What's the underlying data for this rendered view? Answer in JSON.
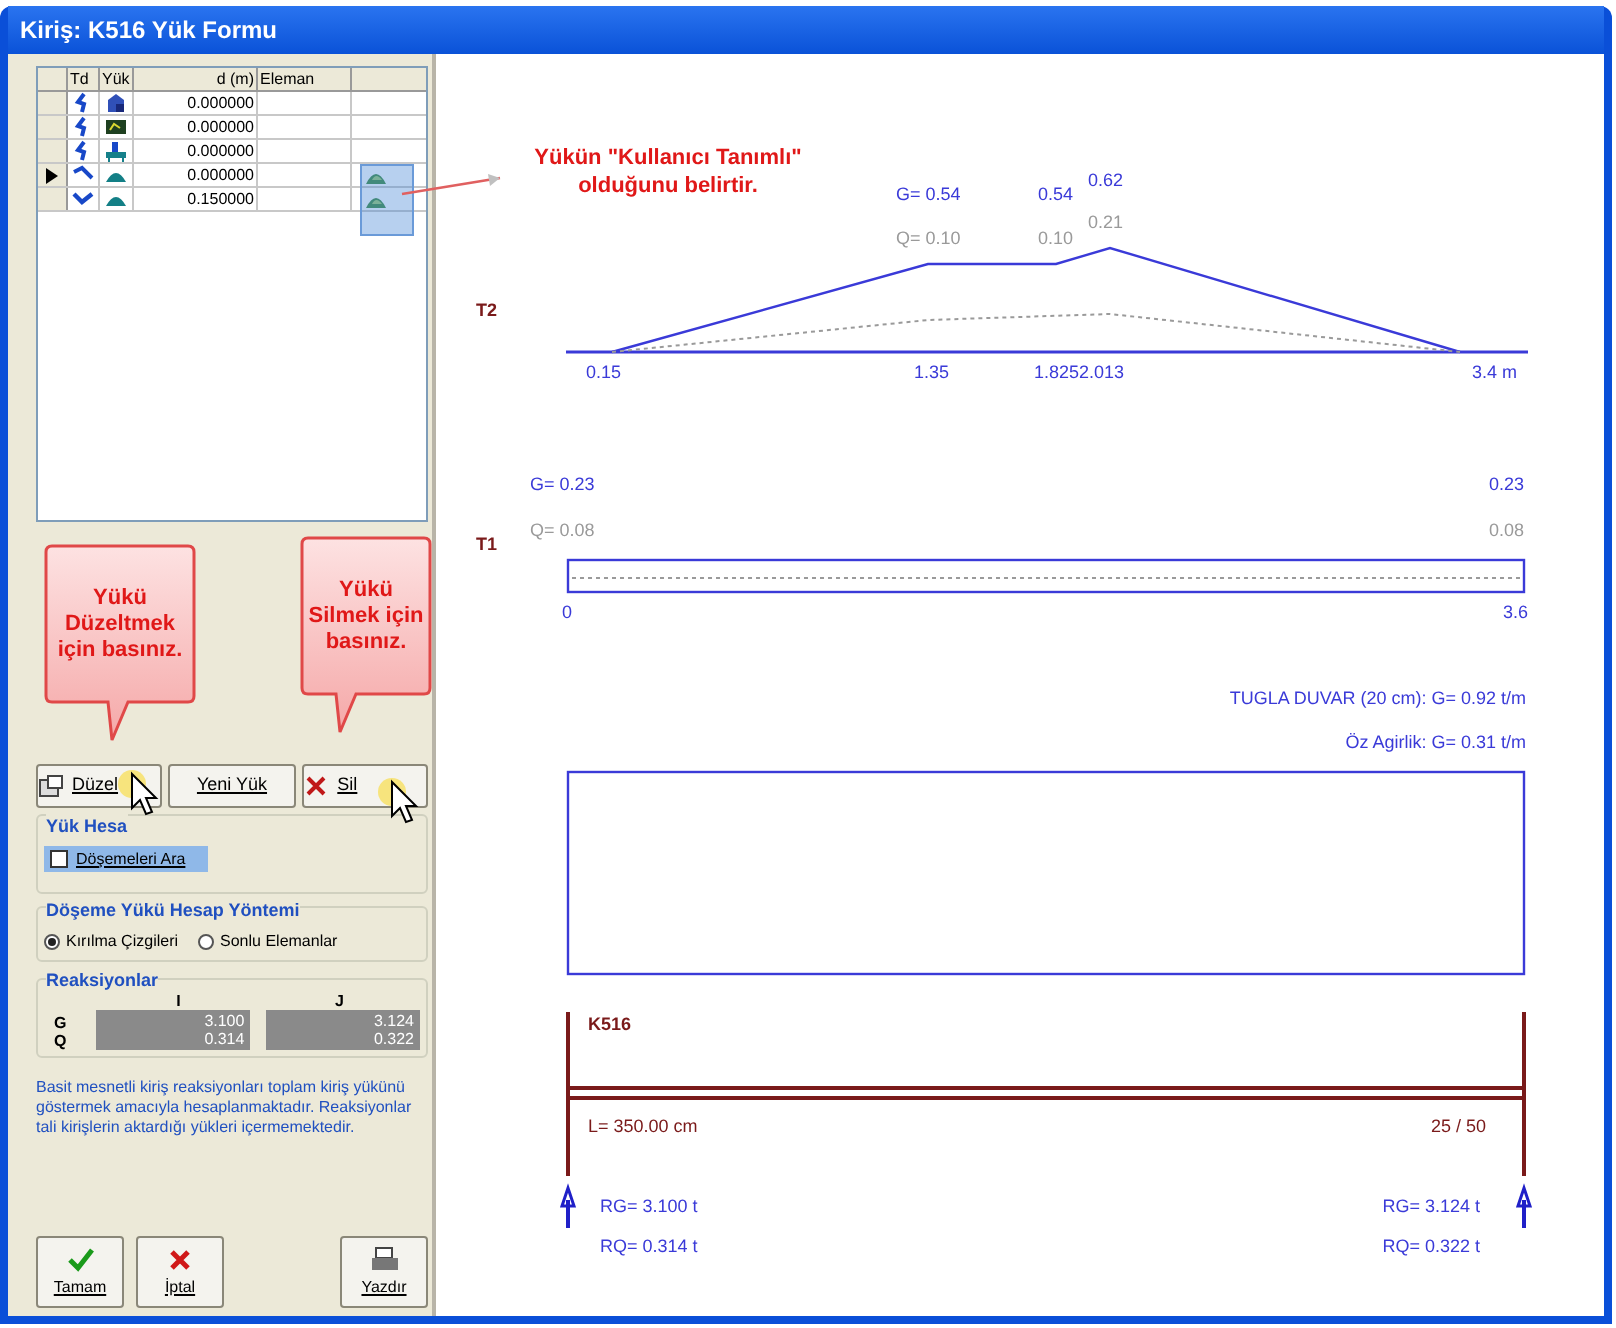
{
  "window": {
    "title": "Kiriş: K516 Yük Formu"
  },
  "grid": {
    "columns": [
      "Td",
      "Yük",
      "d (m)",
      "Eleman"
    ],
    "rows": [
      {
        "selected": false,
        "td": {
          "kind": "hook"
        },
        "load": {
          "kind": "wall"
        },
        "d": "0.000000",
        "user_defined": false
      },
      {
        "selected": false,
        "td": {
          "kind": "hook"
        },
        "load": {
          "kind": "panel"
        },
        "d": "0.000000",
        "user_defined": false
      },
      {
        "selected": false,
        "td": {
          "kind": "hook"
        },
        "load": {
          "kind": "slab"
        },
        "d": "0.000000",
        "user_defined": false
      },
      {
        "selected": true,
        "td": {
          "kind": "slant"
        },
        "load": {
          "kind": "mound"
        },
        "d": "0.000000",
        "user_defined": true
      },
      {
        "selected": false,
        "td": {
          "kind": "down"
        },
        "load": {
          "kind": "mound"
        },
        "d": "0.150000",
        "user_defined": true
      }
    ]
  },
  "callouts": [
    {
      "text": "Yükü Düzeltmek için basınız."
    },
    {
      "text": "Yükü Silmek için basınız."
    }
  ],
  "note": {
    "text": "Yükün \"Kullanıcı Tanımlı\" olduğunu belirtir."
  },
  "buttons": [
    {
      "kind": "edit",
      "label": "Düzel"
    },
    {
      "kind": "new",
      "label": "Yeni Yük"
    },
    {
      "kind": "delete",
      "label": "Sil"
    }
  ],
  "load_calc": {
    "title": "Yük Hesa",
    "checkbox": {
      "label": "Döşemeleri Ara",
      "checked": false
    }
  },
  "method": {
    "title": "Döşeme Yükü Hesap Yöntemi",
    "options": [
      {
        "label": "Kırılma Çizgileri",
        "selected": true
      },
      {
        "label": "Sonlu Elemanlar",
        "selected": false
      }
    ]
  },
  "reactions": {
    "title": "Reaksiyonlar",
    "columns": [
      "I",
      "J"
    ],
    "row_labels": [
      "G",
      "Q"
    ],
    "values": [
      [
        "3.100",
        "0.314"
      ],
      [
        "3.124",
        "0.322"
      ]
    ]
  },
  "info": "Basit mesnetli kiriş reaksiyonları toplam kiriş yükünü göstermek amacıyla hesaplanmaktadır. Reaksiyonlar tali kirişlerin aktardığı yükleri içermemektedir.",
  "footer_buttons": [
    {
      "kind": "ok",
      "label": "Tamam"
    },
    {
      "kind": "cancel",
      "label": "İptal"
    },
    {
      "kind": "print",
      "label": "Yazdır"
    }
  ],
  "diagram": {
    "t2": {
      "label": "T2",
      "g_labels": [
        "G= 0.54",
        "0.54",
        "0.62"
      ],
      "q_labels": [
        "Q= 0.10",
        "0.10",
        "0.21"
      ],
      "x_labels": [
        "0.15",
        "1.35",
        "1.8252.013",
        "3.4 m"
      ]
    },
    "t1": {
      "label": "T1",
      "g_labels": [
        "G= 0.23",
        "0.23"
      ],
      "q_labels": [
        "Q= 0.08",
        "0.08"
      ],
      "x_labels": [
        "0",
        "3.6"
      ]
    },
    "wall_load": "TUGLA DUVAR (20 cm): G= 0.92 t/m",
    "self_weight": "Öz Agirlik: G= 0.31 t/m",
    "beam": {
      "name": "K516",
      "length": "L= 350.00 cm",
      "section": "25 / 50",
      "left": [
        "RG= 3.100 t",
        "RQ= 0.314 t"
      ],
      "right": [
        "RG= 3.124 t",
        "RQ= 0.322 t"
      ]
    }
  }
}
